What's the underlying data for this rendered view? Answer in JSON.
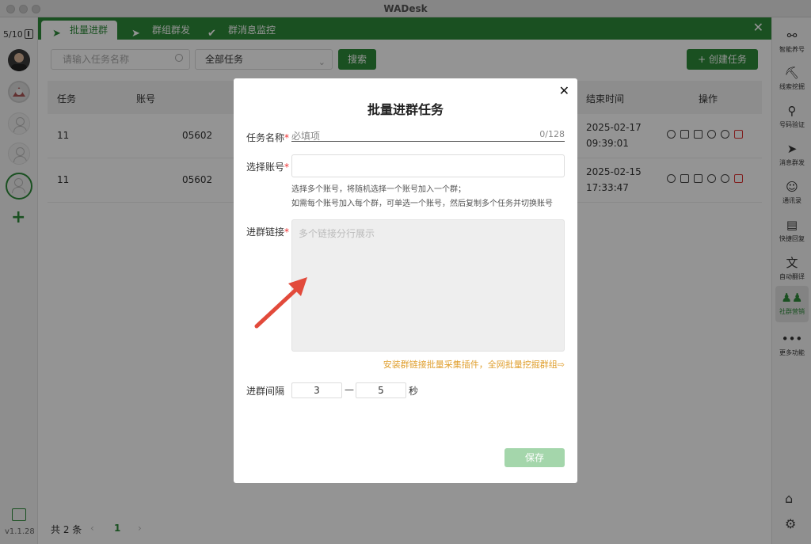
{
  "app": {
    "title": "WADesk",
    "version": "v1.1.28"
  },
  "left_sidebar": {
    "account_count": "5/10"
  },
  "tabs": [
    {
      "label": "批量进群",
      "icon": "send-icon"
    },
    {
      "label": "群组群发",
      "icon": "send-icon"
    },
    {
      "label": "群消息监控",
      "icon": "double-check-icon"
    }
  ],
  "toolbar": {
    "search_placeholder": "请输入任务名称",
    "filter_value": "全部任务",
    "search_button": "搜索",
    "create_button": "+ 创建任务"
  },
  "table": {
    "headers": {
      "task": "任务",
      "account": "账号",
      "end_time": "结束时间",
      "actions": "操作"
    },
    "rows": [
      {
        "task": "11",
        "account": "05602",
        "end_date": "2025-02-17",
        "end_time": "09:39:01"
      },
      {
        "task": "11",
        "account": "05602",
        "end_date": "2025-02-15",
        "end_time": "17:33:47"
      }
    ]
  },
  "pager": {
    "total": "共 2 条",
    "prev": "‹",
    "page": "1",
    "next": "›"
  },
  "right_sidebar": [
    {
      "label": "智能养号",
      "icon": "share-icon"
    },
    {
      "label": "线索挖掘",
      "icon": "user-dig-icon"
    },
    {
      "label": "号码验证",
      "icon": "user-search-icon"
    },
    {
      "label": "消息群发",
      "icon": "send-icon"
    },
    {
      "label": "通讯录",
      "icon": "contacts-icon"
    },
    {
      "label": "快捷回复",
      "icon": "chat-icon"
    },
    {
      "label": "自动翻译",
      "icon": "translate-icon"
    },
    {
      "label": "社群营销",
      "icon": "group-icon"
    },
    {
      "label": "更多功能",
      "icon": "more-icon"
    }
  ],
  "modal": {
    "title": "批量进群任务",
    "close": "✕",
    "name_label": "任务名称",
    "name_placeholder": "必填项",
    "name_count": "0/128",
    "account_label": "选择账号",
    "account_hint_1": "选择多个账号，将随机选择一个账号加入一个群；",
    "account_hint_2": "如需每个账号加入每个群，可单选一个账号，然后复制多个任务并切换账号",
    "links_label": "进群链接",
    "links_placeholder": "多个链接分行展示",
    "plugin_link": "安装群链接批量采集插件，全网批量挖掘群组⇨",
    "interval_label": "进群间隔",
    "interval_min": "3",
    "interval_dash": "—",
    "interval_max": "5",
    "interval_unit": "秒",
    "save_button": "保存",
    "required_mark": "*"
  },
  "colors": {
    "brand": "#2e8b3a",
    "save_disabled": "#a4d6ab",
    "link": "#e0a030",
    "arrow": "#e24a3b"
  }
}
